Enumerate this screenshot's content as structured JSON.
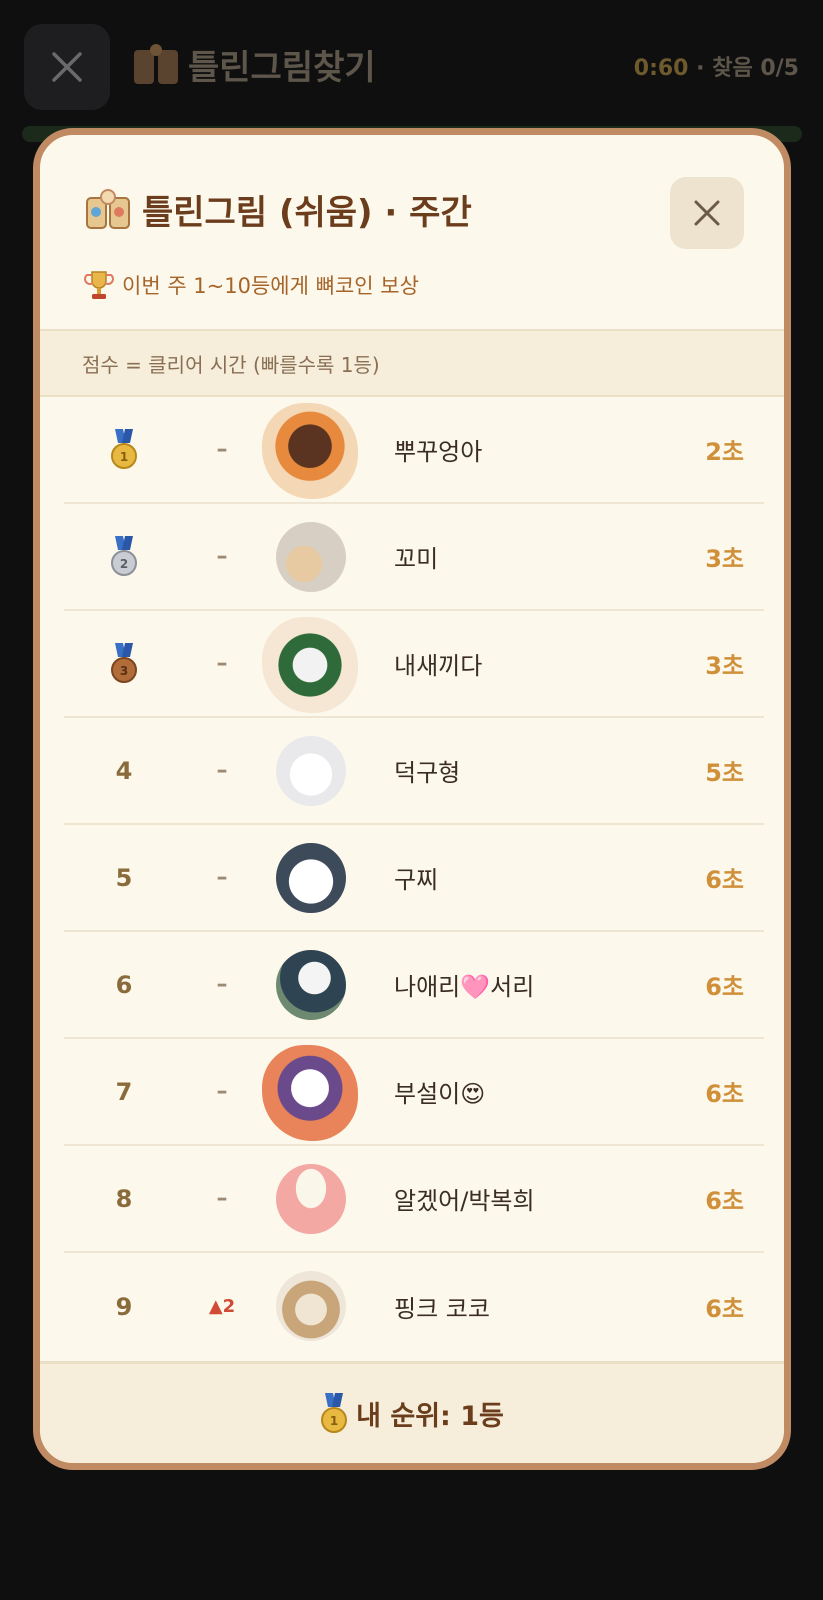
{
  "background": {
    "title": "틀린그림찾기",
    "timer": "0:60",
    "separator": "·",
    "found": "찾음 0/5"
  },
  "modal": {
    "title": "틀린그림 (쉬움) · 주간",
    "reward_text": "이번 주 1~10등에게 뼈코인 보상",
    "score_note": "점수 = 클리어 시간 (빠를수록 1등)",
    "rows": [
      {
        "rank": "1",
        "medal": "gold",
        "change": "–",
        "name": "뿌꾸엉아",
        "score": "2초",
        "frame": true
      },
      {
        "rank": "2",
        "medal": "silver",
        "change": "–",
        "name": "꼬미",
        "score": "3초",
        "frame": false
      },
      {
        "rank": "3",
        "medal": "bronze",
        "change": "–",
        "name": "내새끼다",
        "score": "3초",
        "frame": true
      },
      {
        "rank": "4",
        "medal": "",
        "change": "–",
        "name": "덕구형",
        "score": "5초",
        "frame": false
      },
      {
        "rank": "5",
        "medal": "",
        "change": "–",
        "name": "구찌",
        "score": "6초",
        "frame": false
      },
      {
        "rank": "6",
        "medal": "",
        "change": "–",
        "name": "나애리🩷서리",
        "score": "6초",
        "frame": false
      },
      {
        "rank": "7",
        "medal": "",
        "change": "–",
        "name": "부설이😍",
        "score": "6초",
        "frame": true
      },
      {
        "rank": "8",
        "medal": "",
        "change": "–",
        "name": "알겠어/박복희",
        "score": "6초",
        "frame": false
      },
      {
        "rank": "9",
        "medal": "",
        "change": "▲2",
        "name": "핑크 코코",
        "score": "6초",
        "frame": false
      }
    ],
    "my_rank": "내 순위: 1등"
  },
  "colors": {
    "modal_bg": "#fdf8ec",
    "modal_border": "#c08a63",
    "title_brown": "#6b3d1c",
    "score_gold": "#d0903a",
    "rank_up_red": "#d04a36"
  },
  "icons": {
    "close": "close-icon",
    "title": "puzzle-cards-icon",
    "trophy": "trophy-icon",
    "gold": "gold-medal-icon",
    "silver": "silver-medal-icon",
    "bronze": "bronze-medal-icon"
  }
}
